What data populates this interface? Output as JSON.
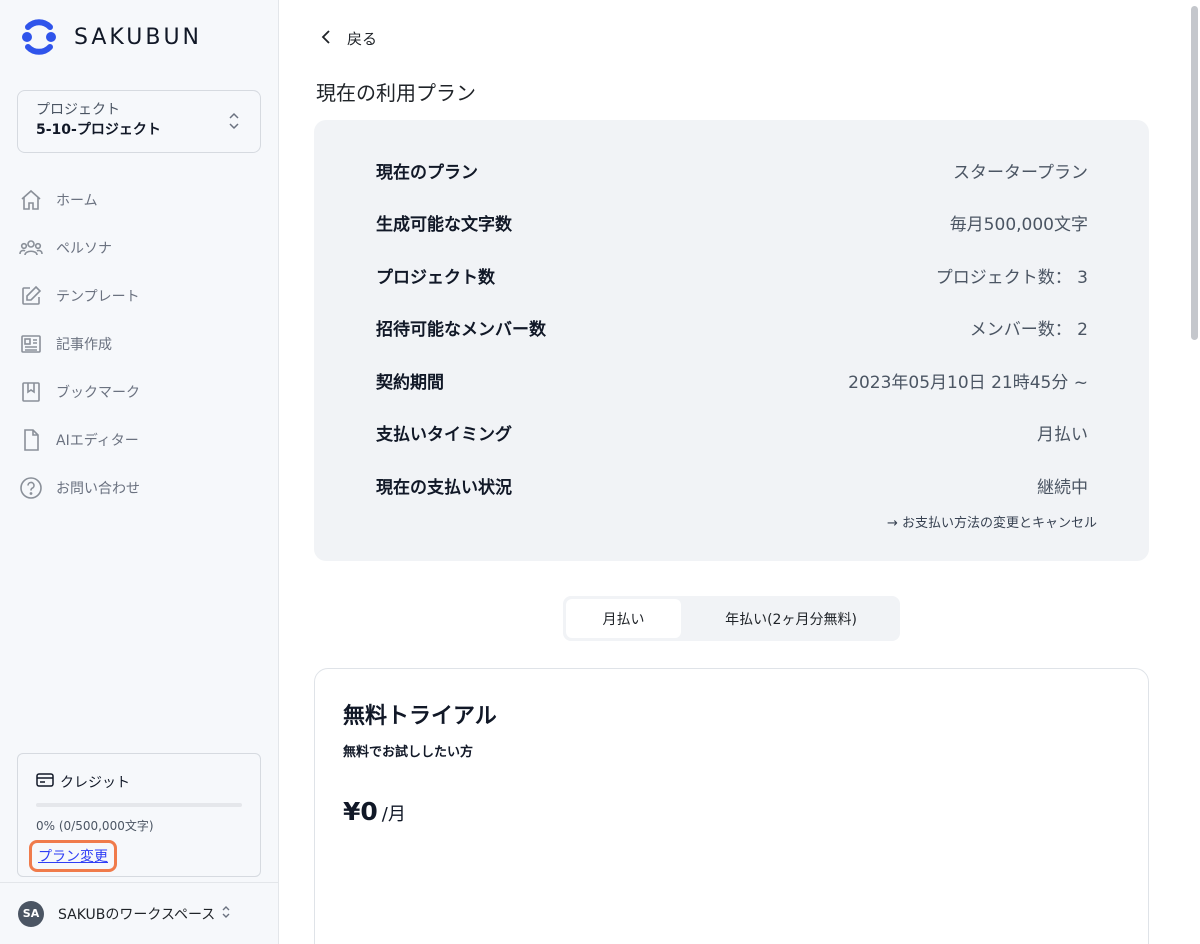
{
  "brand": {
    "name": "SAKUBUN",
    "logo_icon": "sakubun-logo",
    "accent": "#2f54eb"
  },
  "project": {
    "caption": "プロジェクト",
    "name": "5-10-プロジェクト"
  },
  "nav": {
    "items": [
      {
        "label": "ホーム",
        "icon": "home-icon"
      },
      {
        "label": "ペルソナ",
        "icon": "users-icon"
      },
      {
        "label": "テンプレート",
        "icon": "pencil-square-icon"
      },
      {
        "label": "記事作成",
        "icon": "newspaper-icon"
      },
      {
        "label": "ブックマーク",
        "icon": "bookmark-icon"
      },
      {
        "label": "AIエディター",
        "icon": "document-icon"
      },
      {
        "label": "お問い合わせ",
        "icon": "question-circle-icon"
      }
    ]
  },
  "credit": {
    "title": "クレジット",
    "usage_text": "0% (0/500,000文字)",
    "used_fraction": 0,
    "change_plan_label": "プラン変更",
    "highlight_color": "#f07b4b"
  },
  "workspace": {
    "initials": "SA",
    "name": "SAKUBのワークスペース"
  },
  "main": {
    "back_label": "戻る",
    "title": "現在の利用プラン",
    "plan_rows": [
      {
        "key": "現在のプラン",
        "value": "スタータープラン"
      },
      {
        "key": "生成可能な文字数",
        "value": "毎月500,000文字"
      },
      {
        "key": "プロジェクト数",
        "value": "プロジェクト数： 3"
      },
      {
        "key": "招待可能なメンバー数",
        "value": "メンバー数： 2"
      },
      {
        "key": "契約期間",
        "value": "2023年05月10日 21時45分 ~"
      },
      {
        "key": "支払いタイミング",
        "value": "月払い"
      },
      {
        "key": "現在の支払い状況",
        "value": "継続中"
      }
    ],
    "payment_link": "→ お支払い方法の変更とキャンセル",
    "billing_toggle": {
      "monthly": "月払い",
      "yearly": "年払い(2ヶ月分無料)",
      "selected": "monthly"
    },
    "trial": {
      "title": "無料トライアル",
      "subtitle": "無料でお試ししたい方",
      "price": "¥0",
      "unit": "/月"
    }
  }
}
